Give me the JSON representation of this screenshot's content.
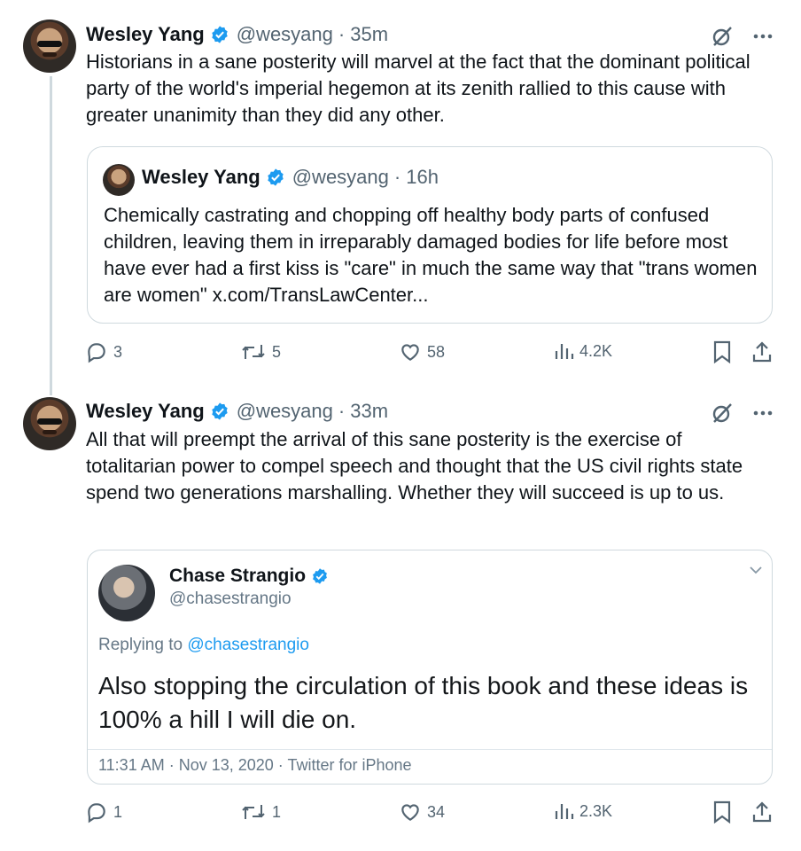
{
  "tweets": [
    {
      "author_name": "Wesley Yang",
      "handle": "@wesyang",
      "time": "35m",
      "text": "Historians in a sane posterity will marvel at the fact that the dominant political party of the world's imperial hegemon at its zenith rallied to this cause with greater unanimity than they did any other.",
      "quote": {
        "author_name": "Wesley Yang",
        "handle": "@wesyang",
        "time": "16h",
        "text": "Chemically castrating and chopping off healthy body parts of confused children, leaving them in irreparably damaged bodies for life before most have ever had a first kiss is \"care\" in much the same way that \"trans women are women\" x.com/TransLawCenter..."
      },
      "actions": {
        "replies": "3",
        "retweets": "5",
        "likes": "58",
        "views": "4.2K"
      }
    },
    {
      "author_name": "Wesley Yang",
      "handle": "@wesyang",
      "time": "33m",
      "text": "All that will preempt the arrival of this sane posterity is the exercise of totalitarian power to compel speech and thought that the US civil rights state spend two generations marshalling. Whether they will succeed is up to us.",
      "embed": {
        "author_name": "Chase Strangio",
        "handle": "@chasestrangio",
        "replying_label": "Replying to",
        "replying_handle": "@chasestrangio",
        "text": "Also stopping the circulation of this book and these ideas is 100% a hill I will die on.",
        "meta": "11:31 AM · Nov 13, 2020 · Twitter for iPhone"
      },
      "actions": {
        "replies": "1",
        "retweets": "1",
        "likes": "34",
        "views": "2.3K"
      }
    }
  ],
  "colors": {
    "verified": "#1d9bf0",
    "secondary_text": "#536471",
    "border": "#cfd9de"
  },
  "icons": [
    "verified-badge-icon",
    "grok-icon",
    "more-icon",
    "reply-icon",
    "retweet-icon",
    "like-icon",
    "views-icon",
    "bookmark-icon",
    "share-icon",
    "chevron-down-icon"
  ]
}
